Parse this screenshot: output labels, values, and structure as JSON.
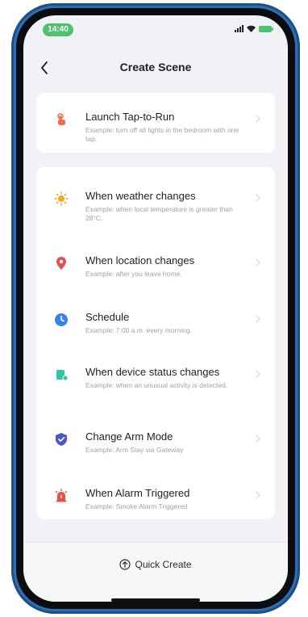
{
  "status_bar": {
    "time": "14:40"
  },
  "nav": {
    "title": "Create Scene"
  },
  "tap_to_run": {
    "title": "Launch Tap-to-Run",
    "desc": "Example: turn off all lights in the bedroom with one tap."
  },
  "conditions": [
    {
      "title": "When weather changes",
      "desc": "Example: when local temperature is greater than 28°C.",
      "icon": "sun-icon",
      "color": "#f5a623"
    },
    {
      "title": "When location changes",
      "desc": "Example: after you leave home.",
      "icon": "location-pin-icon",
      "color": "#e8504a"
    },
    {
      "title": "Schedule",
      "desc": "Example: 7:00 a.m. every morning.",
      "icon": "clock-icon",
      "color": "#3b82f0"
    },
    {
      "title": "When device status changes",
      "desc": "Example: when an unusual activity is detected.",
      "icon": "device-icon",
      "color": "#2fc3a2"
    },
    {
      "title": "Change Arm Mode",
      "desc": "Example: Arm Stay via Gateway",
      "icon": "shield-icon",
      "color": "#4a58c9"
    },
    {
      "title": "When Alarm Triggered",
      "desc": "Example: Smoke Alarm Triggered",
      "icon": "alarm-icon",
      "color": "#e8504a"
    }
  ],
  "footer": {
    "quick_create": "Quick Create"
  },
  "colors": {
    "accent_green": "#4fc26b",
    "frame_blue": "#2d6fb5",
    "tap_icon": "#f06a4f"
  }
}
